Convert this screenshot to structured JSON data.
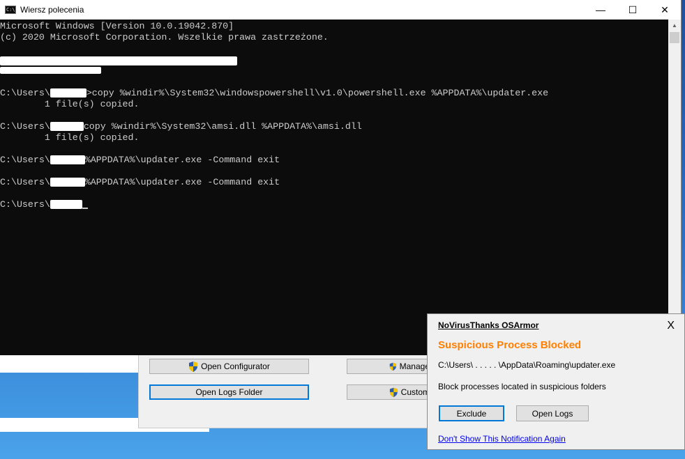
{
  "cmd": {
    "title": "Wiersz polecenia",
    "icon": "cmd-icon",
    "controls": {
      "minimize": "—",
      "maximize": "☐",
      "close": "✕"
    },
    "lines": {
      "version": "Microsoft Windows [Version 10.0.19042.870]",
      "copyright": "(c) 2020 Microsoft Corporation. Wszelkie prawa zastrzeżone.",
      "prompt_prefix": "C:\\Users\\",
      "cmd1": ">copy %windir%\\System32\\windowspowershell\\v1.0\\powershell.exe %APPDATA%\\updater.exe",
      "copied1": "        1 file(s) copied.",
      "cmd2": "copy %windir%\\System32\\amsi.dll %APPDATA%\\amsi.dll",
      "copied2": "        1 file(s) copied.",
      "cmd3": "%APPDATA%\\updater.exe -Command exit",
      "cmd4": "%APPDATA%\\updater.exe -Command exit"
    }
  },
  "osarmor_window": {
    "open_configurator": "Open Configurator",
    "manage": "Manage",
    "open_logs_folder": "Open Logs Folder",
    "custom": "Custom"
  },
  "notification": {
    "app_title": "NoVirusThanks OSArmor",
    "close": "X",
    "heading": "Suspicious Process Blocked",
    "path": "C:\\Users\\ . . . . . \\AppData\\Roaming\\updater.exe",
    "description": "Block processes located in suspicious folders",
    "exclude_button": "Exclude",
    "open_logs_button": "Open Logs",
    "dont_show_link": "Don't Show This Notification Again"
  },
  "colors": {
    "console_bg": "#0c0c0c",
    "console_text": "#cccccc",
    "heading_orange": "#ff7f00",
    "link_blue": "#0000ee",
    "focus_blue": "#0078d7"
  }
}
